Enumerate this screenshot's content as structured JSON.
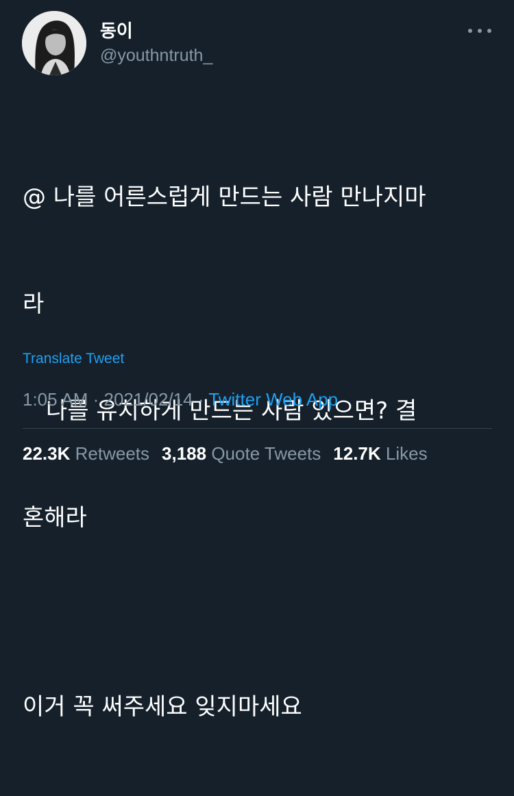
{
  "author": {
    "display_name": "동이",
    "handle": "@youthntruth_",
    "avatar_icon": "profile-photo"
  },
  "more_icon": "more-horizontal-icon",
  "tweet": {
    "lines": [
      "@ 나를 어른스럽게 만드는 사람 만나지마",
      "라",
      "　나를 유치하게 만드는 사람 있으면? 결",
      "혼해라",
      "이거 꼭 써주세요 잊지마세요"
    ]
  },
  "translate_label": "Translate Tweet",
  "meta": {
    "time": "1:05 AM",
    "separator": " · ",
    "date": "2021/02/14",
    "source": "Twitter Web App"
  },
  "stats": {
    "retweets": {
      "value": "22.3K",
      "label": "Retweets"
    },
    "quote_tweets": {
      "value": "3,188",
      "label": "Quote Tweets"
    },
    "likes": {
      "value": "12.7K",
      "label": "Likes"
    }
  },
  "colors": {
    "background": "#15202b",
    "accent": "#1da1f2",
    "secondary_text": "#8899a6",
    "divider": "#38444d"
  }
}
